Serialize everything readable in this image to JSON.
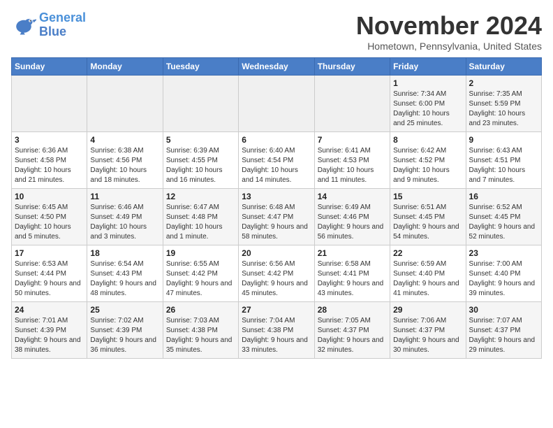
{
  "logo": {
    "line1": "General",
    "line2": "Blue"
  },
  "title": "November 2024",
  "subtitle": "Hometown, Pennsylvania, United States",
  "weekdays": [
    "Sunday",
    "Monday",
    "Tuesday",
    "Wednesday",
    "Thursday",
    "Friday",
    "Saturday"
  ],
  "weeks": [
    [
      {
        "day": "",
        "info": ""
      },
      {
        "day": "",
        "info": ""
      },
      {
        "day": "",
        "info": ""
      },
      {
        "day": "",
        "info": ""
      },
      {
        "day": "",
        "info": ""
      },
      {
        "day": "1",
        "info": "Sunrise: 7:34 AM\nSunset: 6:00 PM\nDaylight: 10 hours and 25 minutes."
      },
      {
        "day": "2",
        "info": "Sunrise: 7:35 AM\nSunset: 5:59 PM\nDaylight: 10 hours and 23 minutes."
      }
    ],
    [
      {
        "day": "3",
        "info": "Sunrise: 6:36 AM\nSunset: 4:58 PM\nDaylight: 10 hours and 21 minutes."
      },
      {
        "day": "4",
        "info": "Sunrise: 6:38 AM\nSunset: 4:56 PM\nDaylight: 10 hours and 18 minutes."
      },
      {
        "day": "5",
        "info": "Sunrise: 6:39 AM\nSunset: 4:55 PM\nDaylight: 10 hours and 16 minutes."
      },
      {
        "day": "6",
        "info": "Sunrise: 6:40 AM\nSunset: 4:54 PM\nDaylight: 10 hours and 14 minutes."
      },
      {
        "day": "7",
        "info": "Sunrise: 6:41 AM\nSunset: 4:53 PM\nDaylight: 10 hours and 11 minutes."
      },
      {
        "day": "8",
        "info": "Sunrise: 6:42 AM\nSunset: 4:52 PM\nDaylight: 10 hours and 9 minutes."
      },
      {
        "day": "9",
        "info": "Sunrise: 6:43 AM\nSunset: 4:51 PM\nDaylight: 10 hours and 7 minutes."
      }
    ],
    [
      {
        "day": "10",
        "info": "Sunrise: 6:45 AM\nSunset: 4:50 PM\nDaylight: 10 hours and 5 minutes."
      },
      {
        "day": "11",
        "info": "Sunrise: 6:46 AM\nSunset: 4:49 PM\nDaylight: 10 hours and 3 minutes."
      },
      {
        "day": "12",
        "info": "Sunrise: 6:47 AM\nSunset: 4:48 PM\nDaylight: 10 hours and 1 minute."
      },
      {
        "day": "13",
        "info": "Sunrise: 6:48 AM\nSunset: 4:47 PM\nDaylight: 9 hours and 58 minutes."
      },
      {
        "day": "14",
        "info": "Sunrise: 6:49 AM\nSunset: 4:46 PM\nDaylight: 9 hours and 56 minutes."
      },
      {
        "day": "15",
        "info": "Sunrise: 6:51 AM\nSunset: 4:45 PM\nDaylight: 9 hours and 54 minutes."
      },
      {
        "day": "16",
        "info": "Sunrise: 6:52 AM\nSunset: 4:45 PM\nDaylight: 9 hours and 52 minutes."
      }
    ],
    [
      {
        "day": "17",
        "info": "Sunrise: 6:53 AM\nSunset: 4:44 PM\nDaylight: 9 hours and 50 minutes."
      },
      {
        "day": "18",
        "info": "Sunrise: 6:54 AM\nSunset: 4:43 PM\nDaylight: 9 hours and 48 minutes."
      },
      {
        "day": "19",
        "info": "Sunrise: 6:55 AM\nSunset: 4:42 PM\nDaylight: 9 hours and 47 minutes."
      },
      {
        "day": "20",
        "info": "Sunrise: 6:56 AM\nSunset: 4:42 PM\nDaylight: 9 hours and 45 minutes."
      },
      {
        "day": "21",
        "info": "Sunrise: 6:58 AM\nSunset: 4:41 PM\nDaylight: 9 hours and 43 minutes."
      },
      {
        "day": "22",
        "info": "Sunrise: 6:59 AM\nSunset: 4:40 PM\nDaylight: 9 hours and 41 minutes."
      },
      {
        "day": "23",
        "info": "Sunrise: 7:00 AM\nSunset: 4:40 PM\nDaylight: 9 hours and 39 minutes."
      }
    ],
    [
      {
        "day": "24",
        "info": "Sunrise: 7:01 AM\nSunset: 4:39 PM\nDaylight: 9 hours and 38 minutes."
      },
      {
        "day": "25",
        "info": "Sunrise: 7:02 AM\nSunset: 4:39 PM\nDaylight: 9 hours and 36 minutes."
      },
      {
        "day": "26",
        "info": "Sunrise: 7:03 AM\nSunset: 4:38 PM\nDaylight: 9 hours and 35 minutes."
      },
      {
        "day": "27",
        "info": "Sunrise: 7:04 AM\nSunset: 4:38 PM\nDaylight: 9 hours and 33 minutes."
      },
      {
        "day": "28",
        "info": "Sunrise: 7:05 AM\nSunset: 4:37 PM\nDaylight: 9 hours and 32 minutes."
      },
      {
        "day": "29",
        "info": "Sunrise: 7:06 AM\nSunset: 4:37 PM\nDaylight: 9 hours and 30 minutes."
      },
      {
        "day": "30",
        "info": "Sunrise: 7:07 AM\nSunset: 4:37 PM\nDaylight: 9 hours and 29 minutes."
      }
    ]
  ]
}
